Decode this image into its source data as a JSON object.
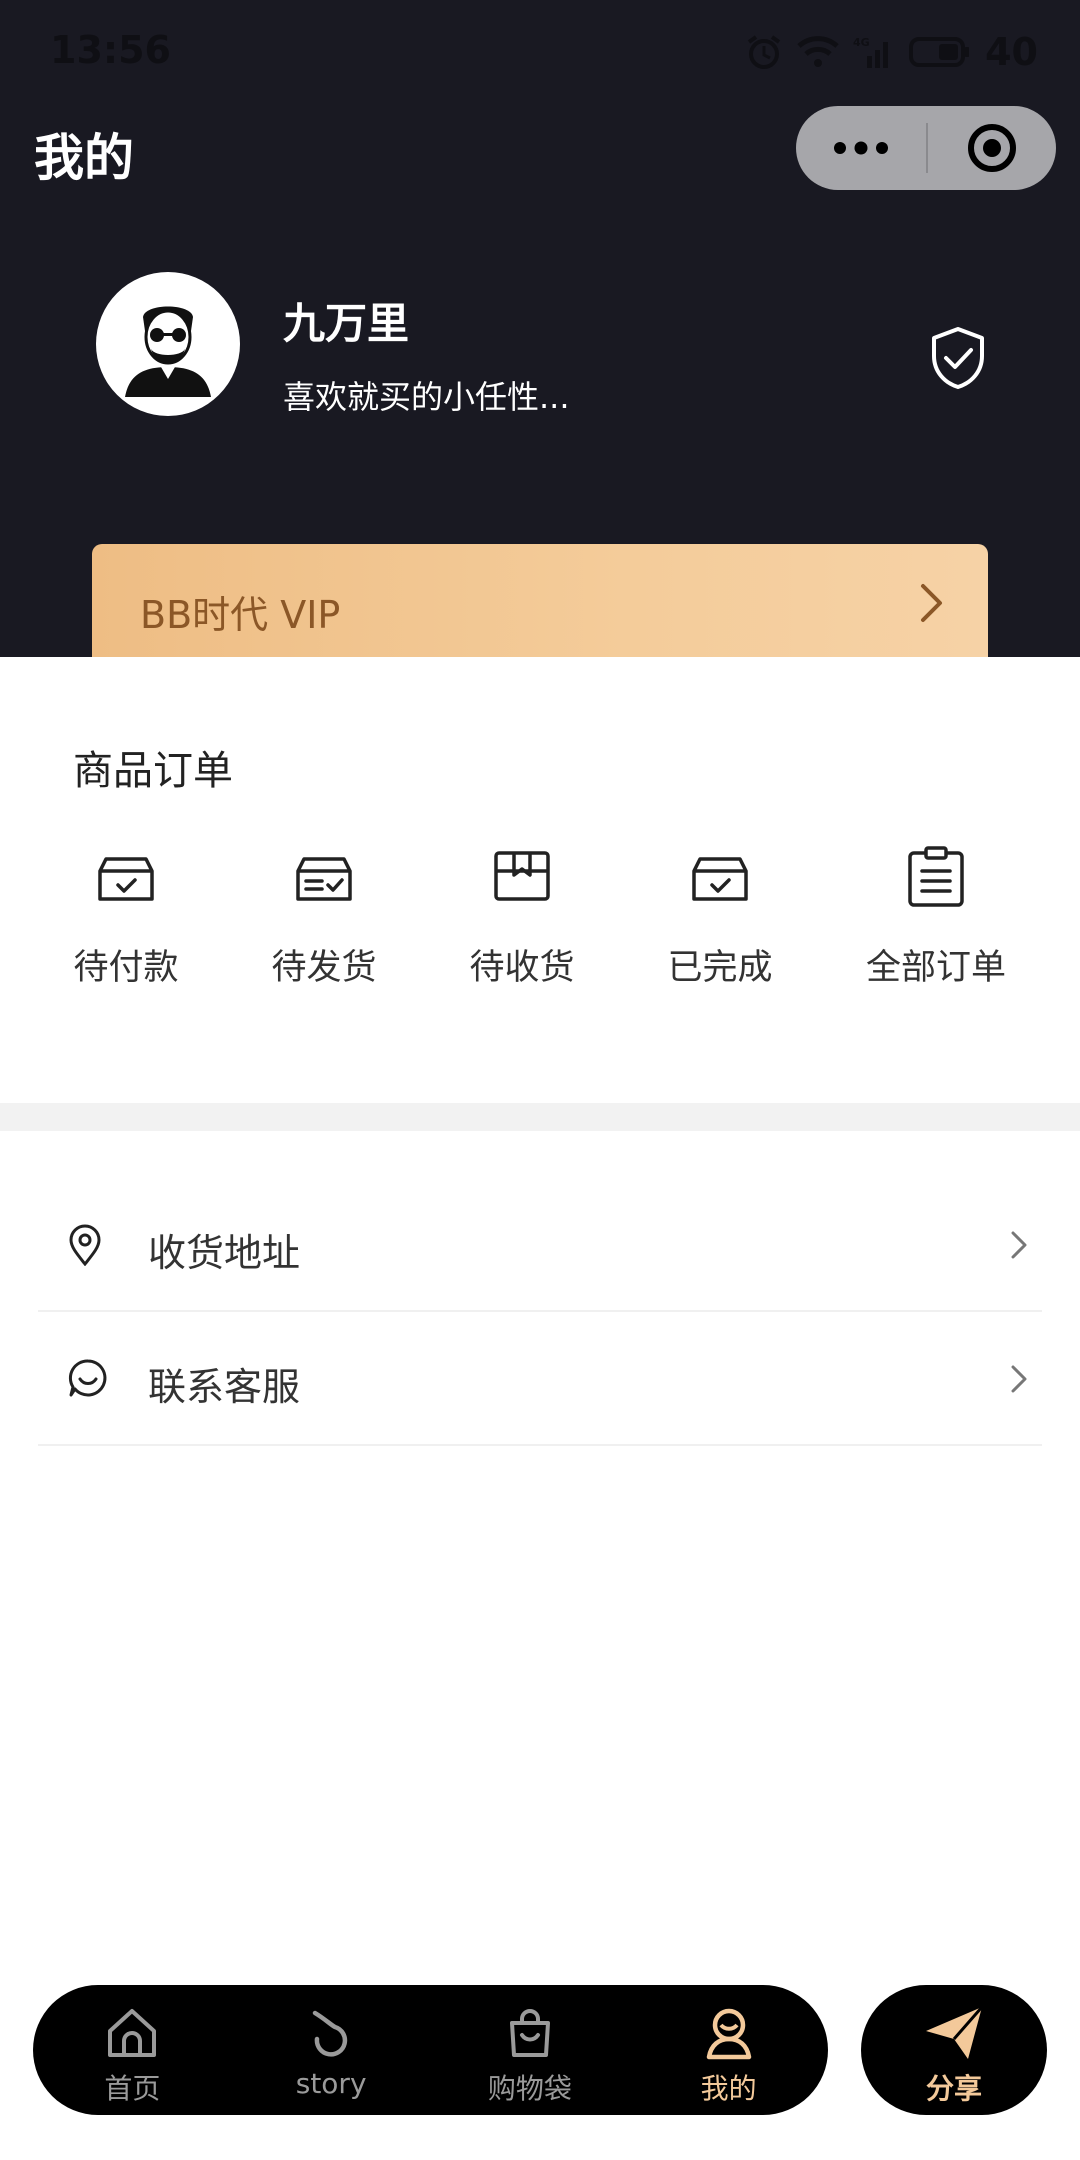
{
  "status_bar": {
    "time": "13:56",
    "battery": "40",
    "network": "4G"
  },
  "header": {
    "title": "我的"
  },
  "user": {
    "name": "九万里",
    "bio": "喜欢就买的小任性..."
  },
  "vip": {
    "label": "BB时代 VIP"
  },
  "orders": {
    "title": "商品订单",
    "items": [
      {
        "label": "待付款",
        "icon": "box-check-icon"
      },
      {
        "label": "待发货",
        "icon": "box-list-icon"
      },
      {
        "label": "待收货",
        "icon": "package-open-icon"
      },
      {
        "label": "已完成",
        "icon": "box-check-icon"
      },
      {
        "label": "全部订单",
        "icon": "clipboard-list-icon"
      }
    ]
  },
  "menu": [
    {
      "label": "收货地址",
      "icon": "location-pin-icon"
    },
    {
      "label": "联系客服",
      "icon": "smile-chat-icon"
    }
  ],
  "tabbar": {
    "tabs": [
      {
        "label": "首页",
        "icon": "home-icon",
        "active": false
      },
      {
        "label": "story",
        "icon": "story-icon",
        "active": false
      },
      {
        "label": "购物袋",
        "icon": "shopping-bag-icon",
        "active": false
      },
      {
        "label": "我的",
        "icon": "profile-icon",
        "active": true
      }
    ],
    "share_label": "分享"
  },
  "colors": {
    "header_bg": "#191922",
    "vip_gradient_start": "#eebd84",
    "vip_text": "#8b5727",
    "active_tab": "#f3c99a",
    "tabbar_bg": "#000000"
  }
}
